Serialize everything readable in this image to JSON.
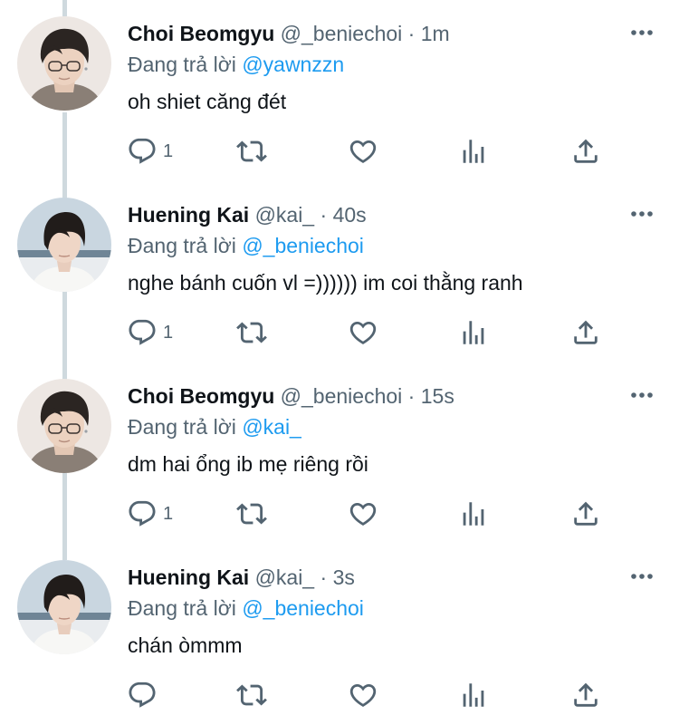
{
  "tweets": [
    {
      "name": "Choi Beomgyu",
      "handle": "@_beniechoi",
      "dot": "·",
      "time": "1m",
      "reply_prefix": "Đang trả lời",
      "reply_to": "@yawnzzn",
      "text": "oh shiet căng đét",
      "reply_count": "1",
      "avatar": "beomgyu"
    },
    {
      "name": "Huening Kai",
      "handle": "@kai_",
      "dot": "·",
      "time": "40s",
      "reply_prefix": "Đang trả lời",
      "reply_to": "@_beniechoi",
      "text": "nghe bánh cuốn vl =)))))) im coi thằng ranh",
      "reply_count": "1",
      "avatar": "kai"
    },
    {
      "name": "Choi Beomgyu",
      "handle": "@_beniechoi",
      "dot": "·",
      "time": "15s",
      "reply_prefix": "Đang trả lời",
      "reply_to": "@kai_",
      "text": "dm hai ổng ib mẹ riêng rồi",
      "reply_count": "1",
      "avatar": "beomgyu"
    },
    {
      "name": "Huening Kai",
      "handle": "@kai_",
      "dot": "·",
      "time": "3s",
      "reply_prefix": "Đang trả lời",
      "reply_to": "@_beniechoi",
      "text": "chán òmmm",
      "reply_count": "",
      "avatar": "kai"
    }
  ],
  "icons": {
    "reply": "reply-icon",
    "retweet": "retweet-icon",
    "like": "heart-icon",
    "views": "views-icon",
    "share": "share-icon",
    "more": "more-icon"
  },
  "colors": {
    "text": "#0f1419",
    "secondary": "#536471",
    "mention": "#1d9bf0",
    "thread_line": "#cfd9de"
  }
}
